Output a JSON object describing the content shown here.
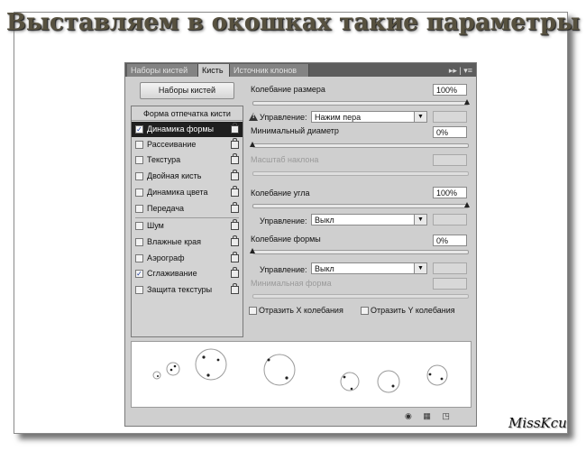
{
  "heading": "Выставляем в окошках такие параметры",
  "signature": "MissKcu",
  "tabs": [
    {
      "label": "Наборы кистей",
      "active": false
    },
    {
      "label": "Кисть",
      "active": true
    },
    {
      "label": "Источник клонов",
      "active": false
    }
  ],
  "tab_icons": "▸▸ | ▾≡",
  "presets_button": "Наборы кистей",
  "left_list": {
    "header": "Форма отпечатка кисти",
    "items": [
      {
        "label": "Динамика формы",
        "checked": true,
        "selected": true
      },
      {
        "label": "Рассеивание",
        "checked": false
      },
      {
        "label": "Текстура",
        "checked": false
      },
      {
        "label": "Двойная кисть",
        "checked": false
      },
      {
        "label": "Динамика цвета",
        "checked": false
      },
      {
        "label": "Передача",
        "checked": false
      },
      {
        "label": "Шум",
        "checked": false
      },
      {
        "label": "Влажные края",
        "checked": false
      },
      {
        "label": "Аэрограф",
        "checked": false
      },
      {
        "label": "Сглаживание",
        "checked": true
      },
      {
        "label": "Защита текстуры",
        "checked": false
      }
    ]
  },
  "size_jitter": {
    "label": "Колебание размера",
    "value": "100%",
    "level": 1.0
  },
  "control1": {
    "label": "Управление:",
    "value": "Нажим пера"
  },
  "min_diameter": {
    "label": "Минимальный диаметр",
    "value": "0%",
    "level": 0.0
  },
  "tilt_scale": {
    "label": "Масштаб наклона"
  },
  "angle_jitter": {
    "label": "Колебание угла",
    "value": "100%",
    "level": 1.0
  },
  "control2": {
    "label": "Управление:",
    "value": "Выкл"
  },
  "roundness_jitter": {
    "label": "Колебание формы",
    "value": "0%",
    "level": 0.0
  },
  "control3": {
    "label": "Управление:",
    "value": "Выкл"
  },
  "min_roundness": {
    "label": "Минимальная форма"
  },
  "flip_x": {
    "label": "Отразить X колебания",
    "checked": false
  },
  "flip_y": {
    "label": "Отразить Y колебания",
    "checked": false
  },
  "colors": {
    "panel": "#cfcfcf",
    "tabbar": "#5d5d5d",
    "selected": "#1f1f1f",
    "heading": "#57513f"
  }
}
